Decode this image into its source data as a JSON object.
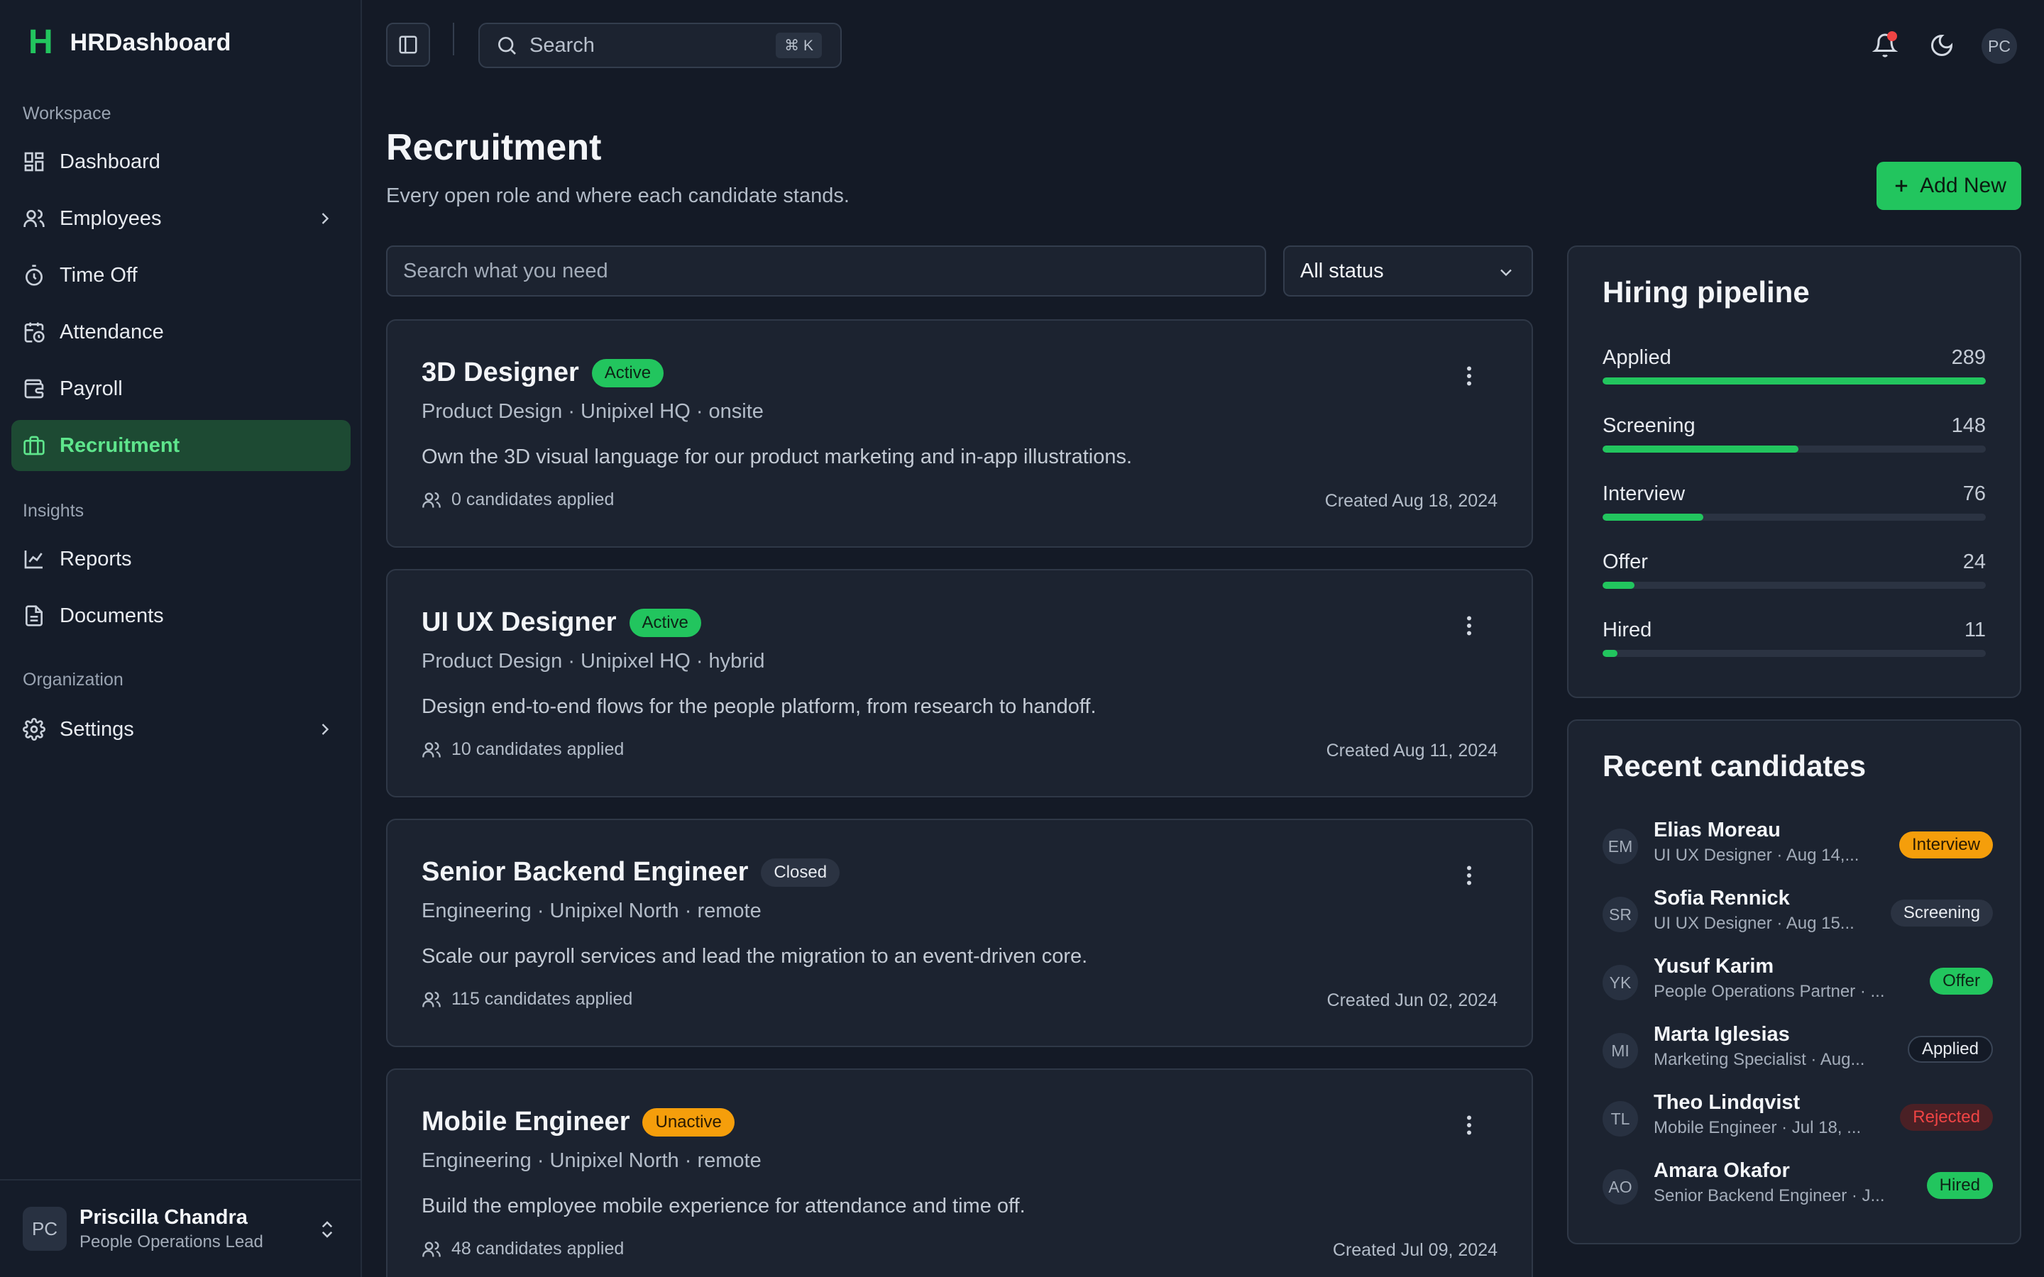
{
  "brand": {
    "logo": "H",
    "name": "HRDashboard"
  },
  "sidebar": {
    "sections": {
      "workspace": "Workspace",
      "insights": "Insights",
      "organization": "Organization"
    },
    "items": [
      {
        "label": "Dashboard",
        "icon": "dashboard-icon"
      },
      {
        "label": "Employees",
        "icon": "users-icon"
      },
      {
        "label": "Time Off",
        "icon": "timer-icon"
      },
      {
        "label": "Attendance",
        "icon": "calendar-clock-icon"
      },
      {
        "label": "Payroll",
        "icon": "wallet-icon"
      },
      {
        "label": "Recruitment",
        "icon": "briefcase-icon",
        "active": true
      },
      {
        "label": "Reports",
        "icon": "chart-line-icon"
      },
      {
        "label": "Documents",
        "icon": "document-icon"
      },
      {
        "label": "Settings",
        "icon": "gear-icon"
      }
    ],
    "user": {
      "initials": "PC",
      "name": "Priscilla Chandra",
      "role": "People Operations Lead"
    }
  },
  "topbar": {
    "search_placeholder": "Search",
    "shortcut": "⌘ K",
    "avatar_initials": "PC"
  },
  "page": {
    "title": "Recruitment",
    "subtitle": "Every open role and where each candidate stands.",
    "add_button": "Add New",
    "filter_placeholder": "Search what you need",
    "status_select": "All status"
  },
  "jobs": [
    {
      "title": "3D Designer",
      "status": "Active",
      "meta": "Product Design · Unipixel HQ · onsite",
      "description": "Own the 3D visual language for our product marketing and in-app illustrations.",
      "candidates": "0 candidates applied",
      "created": "Created Aug 18, 2024"
    },
    {
      "title": "UI UX Designer",
      "status": "Active",
      "meta": "Product Design · Unipixel HQ · hybrid",
      "description": "Design end-to-end flows for the people platform, from research to handoff.",
      "candidates": "10 candidates applied",
      "created": "Created Aug 11, 2024"
    },
    {
      "title": "Senior Backend Engineer",
      "status": "Closed",
      "meta": "Engineering · Unipixel North · remote",
      "description": "Scale our payroll services and lead the migration to an event-driven core.",
      "candidates": "115 candidates applied",
      "created": "Created Jun 02, 2024"
    },
    {
      "title": "Mobile Engineer",
      "status": "Unactive",
      "meta": "Engineering · Unipixel North · remote",
      "description": "Build the employee mobile experience for attendance and time off.",
      "candidates": "48 candidates applied",
      "created": "Created Jul 09, 2024"
    }
  ],
  "pipeline": {
    "title": "Hiring pipeline",
    "stages": [
      {
        "label": "Applied",
        "value": "289",
        "fill": 1.0
      },
      {
        "label": "Screening",
        "value": "148",
        "fill": 0.512
      },
      {
        "label": "Interview",
        "value": "76",
        "fill": 0.263
      },
      {
        "label": "Offer",
        "value": "24",
        "fill": 0.083
      },
      {
        "label": "Hired",
        "value": "11",
        "fill": 0.038
      }
    ]
  },
  "recent": {
    "title": "Recent candidates",
    "candidates": [
      {
        "initials": "EM",
        "name": "Elias Moreau",
        "sub": "UI UX Designer · Aug 14,...",
        "status": "Interview"
      },
      {
        "initials": "SR",
        "name": "Sofia Rennick",
        "sub": "UI UX Designer · Aug 15...",
        "status": "Screening"
      },
      {
        "initials": "YK",
        "name": "Yusuf Karim",
        "sub": "People Operations Partner · ...",
        "status": "Offer"
      },
      {
        "initials": "MI",
        "name": "Marta Iglesias",
        "sub": "Marketing Specialist · Aug...",
        "status": "Applied"
      },
      {
        "initials": "TL",
        "name": "Theo Lindqvist",
        "sub": "Mobile Engineer · Jul 18, ...",
        "status": "Rejected"
      },
      {
        "initials": "AO",
        "name": "Amara Okafor",
        "sub": "Senior Backend Engineer · J...",
        "status": "Hired"
      }
    ]
  },
  "colors": {
    "accent": "#22c55e",
    "warning": "#f59e0b",
    "danger": "#ef4444",
    "background": "#141a26",
    "surface": "#1c2330"
  }
}
